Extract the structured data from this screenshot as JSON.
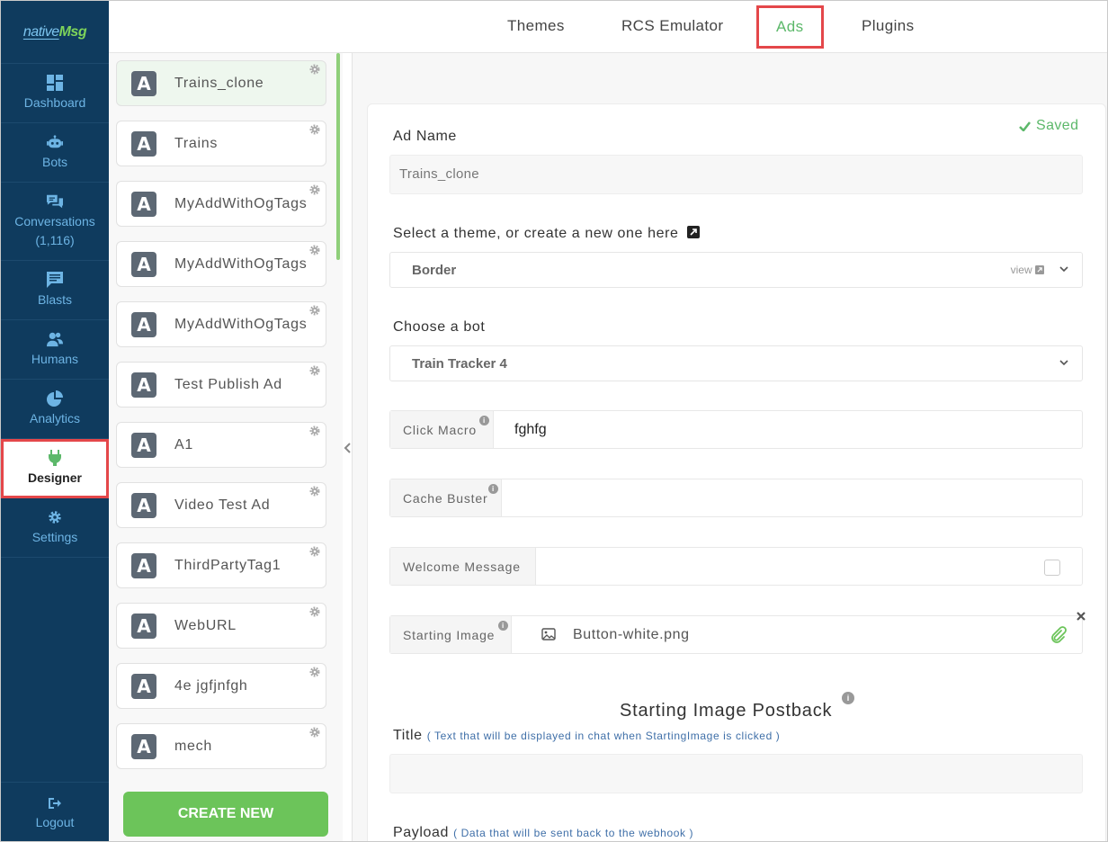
{
  "brand": {
    "part1": "native",
    "part2": "Msg"
  },
  "sidebar": {
    "items": [
      {
        "label": "Dashboard"
      },
      {
        "label": "Bots"
      },
      {
        "label": "Conversations",
        "count": "(1,116)"
      },
      {
        "label": "Blasts"
      },
      {
        "label": "Humans"
      },
      {
        "label": "Analytics"
      },
      {
        "label": "Designer"
      },
      {
        "label": "Settings"
      }
    ],
    "logout": "Logout"
  },
  "tabs": [
    {
      "label": "Themes"
    },
    {
      "label": "RCS Emulator"
    },
    {
      "label": "Ads"
    },
    {
      "label": "Plugins"
    }
  ],
  "ads": [
    "Trains_clone",
    "Trains",
    "MyAddWithOgTags",
    "MyAddWithOgTags",
    "MyAddWithOgTags",
    "Test Publish Ad",
    "A1",
    "Video Test Ad",
    "ThirdPartyTag1",
    "WebURL",
    "4e jgfjnfgh",
    "mech"
  ],
  "ad_logo_letter": "A",
  "create_button": "CREATE NEW",
  "form": {
    "status": "Saved",
    "ad_name_label": "Ad Name",
    "ad_name_value": "Trains_clone",
    "theme_label": "Select a theme, or create a new one here",
    "theme_value": "Border",
    "theme_view": "view",
    "bot_label": "Choose a bot",
    "bot_value": "Train Tracker 4",
    "click_macro_label": "Click Macro",
    "click_macro_value": "fghfg",
    "cache_buster_label": "Cache Buster",
    "welcome_label": "Welcome Message",
    "starting_image_label": "Starting Image",
    "starting_image_file": "Button-white.png",
    "postback_heading": "Starting Image Postback",
    "title_label": "Title",
    "title_hint": "( Text that will be displayed in chat when StartingImage is clicked )",
    "payload_label": "Payload",
    "payload_hint": "( Data that will be sent back to the webhook )"
  },
  "colors": {
    "sidebar_bg": "#0f3b5e",
    "accent_green": "#6cc45a",
    "highlight_red": "#e4474a",
    "link_blue": "#3f6fa8"
  }
}
